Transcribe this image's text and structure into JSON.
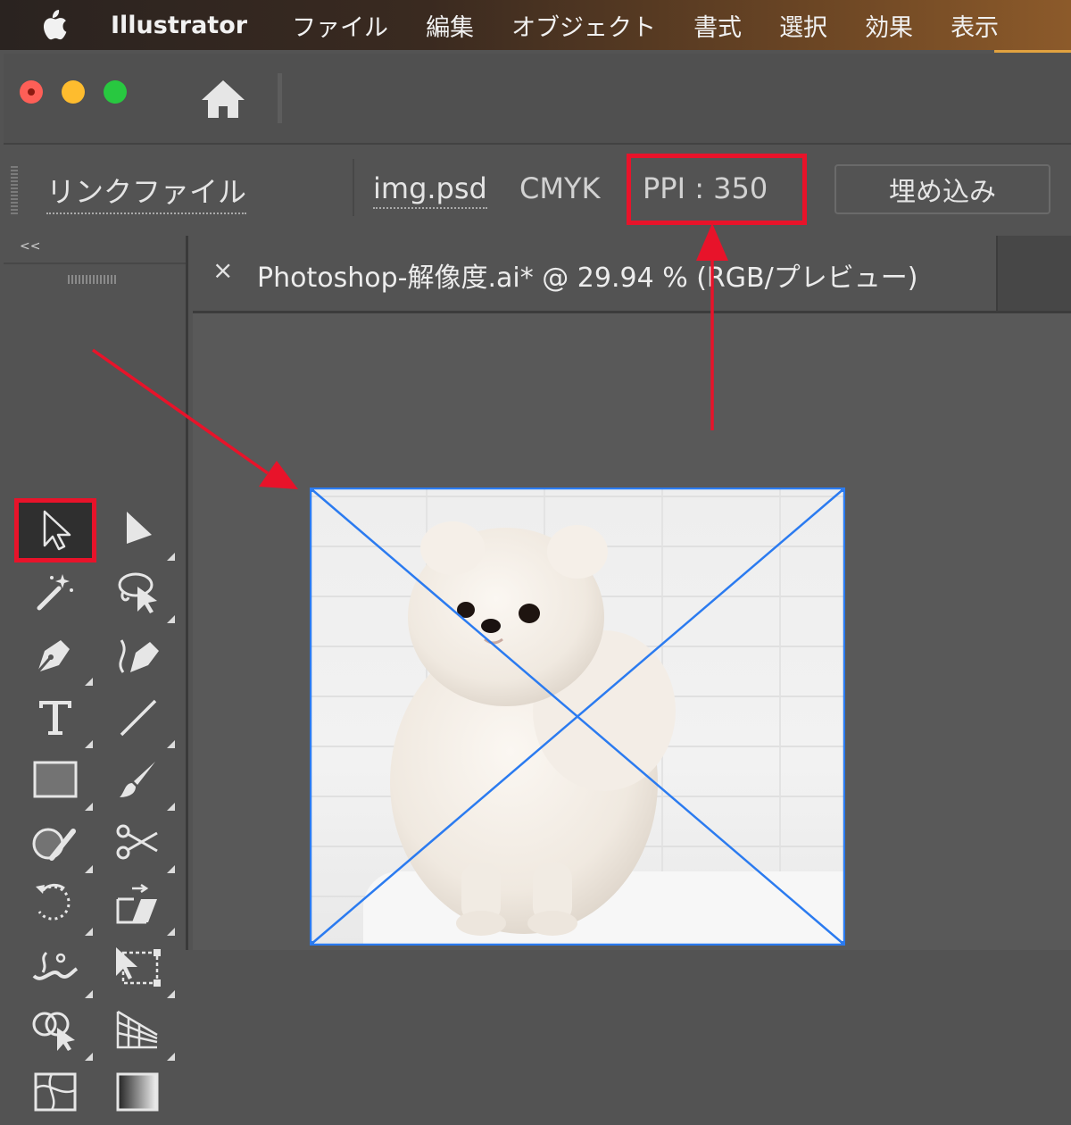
{
  "menubar": {
    "app_name": "Illustrator",
    "items": [
      "ファイル",
      "編集",
      "オブジェクト",
      "書式",
      "選択",
      "効果",
      "表示"
    ]
  },
  "control_bar": {
    "link_label": "リンクファイル",
    "filename": "img.psd",
    "color_mode": "CMYK",
    "ppi": "PPI : 350",
    "embed_button": "埋め込み"
  },
  "document": {
    "tab_close": "×",
    "tab_title": "Photoshop-解像度.ai* @ 29.94 % (RGB/プレビュー)"
  },
  "toolbar": {
    "collapse": "<<",
    "tools": [
      {
        "name": "selection-tool",
        "icon": "arrow-outline-icon",
        "selected": true
      },
      {
        "name": "direct-selection-tool",
        "icon": "arrow-filled-icon"
      },
      {
        "name": "magic-wand-tool",
        "icon": "magic-wand-icon"
      },
      {
        "name": "lasso-tool",
        "icon": "lasso-icon"
      },
      {
        "name": "pen-tool",
        "icon": "pen-icon"
      },
      {
        "name": "curvature-tool",
        "icon": "curvature-pen-icon"
      },
      {
        "name": "type-tool",
        "icon": "type-icon"
      },
      {
        "name": "line-segment-tool",
        "icon": "line-icon"
      },
      {
        "name": "rectangle-tool",
        "icon": "rectangle-icon"
      },
      {
        "name": "paintbrush-tool",
        "icon": "brush-icon"
      },
      {
        "name": "shaper-tool",
        "icon": "shaper-icon"
      },
      {
        "name": "scissors-tool",
        "icon": "scissors-icon"
      },
      {
        "name": "rotate-tool",
        "icon": "rotate-icon"
      },
      {
        "name": "scale-tool",
        "icon": "scale-icon"
      },
      {
        "name": "width-tool",
        "icon": "width-icon"
      },
      {
        "name": "free-transform-tool",
        "icon": "free-transform-icon"
      },
      {
        "name": "shape-builder-tool",
        "icon": "shape-builder-icon"
      },
      {
        "name": "perspective-grid-tool",
        "icon": "perspective-grid-icon"
      },
      {
        "name": "mesh-tool",
        "icon": "mesh-icon"
      },
      {
        "name": "gradient-tool",
        "icon": "gradient-icon"
      }
    ]
  },
  "colors": {
    "highlight": "#e8132a",
    "selection": "#2b7bf0",
    "ui_bg": "#535353"
  }
}
